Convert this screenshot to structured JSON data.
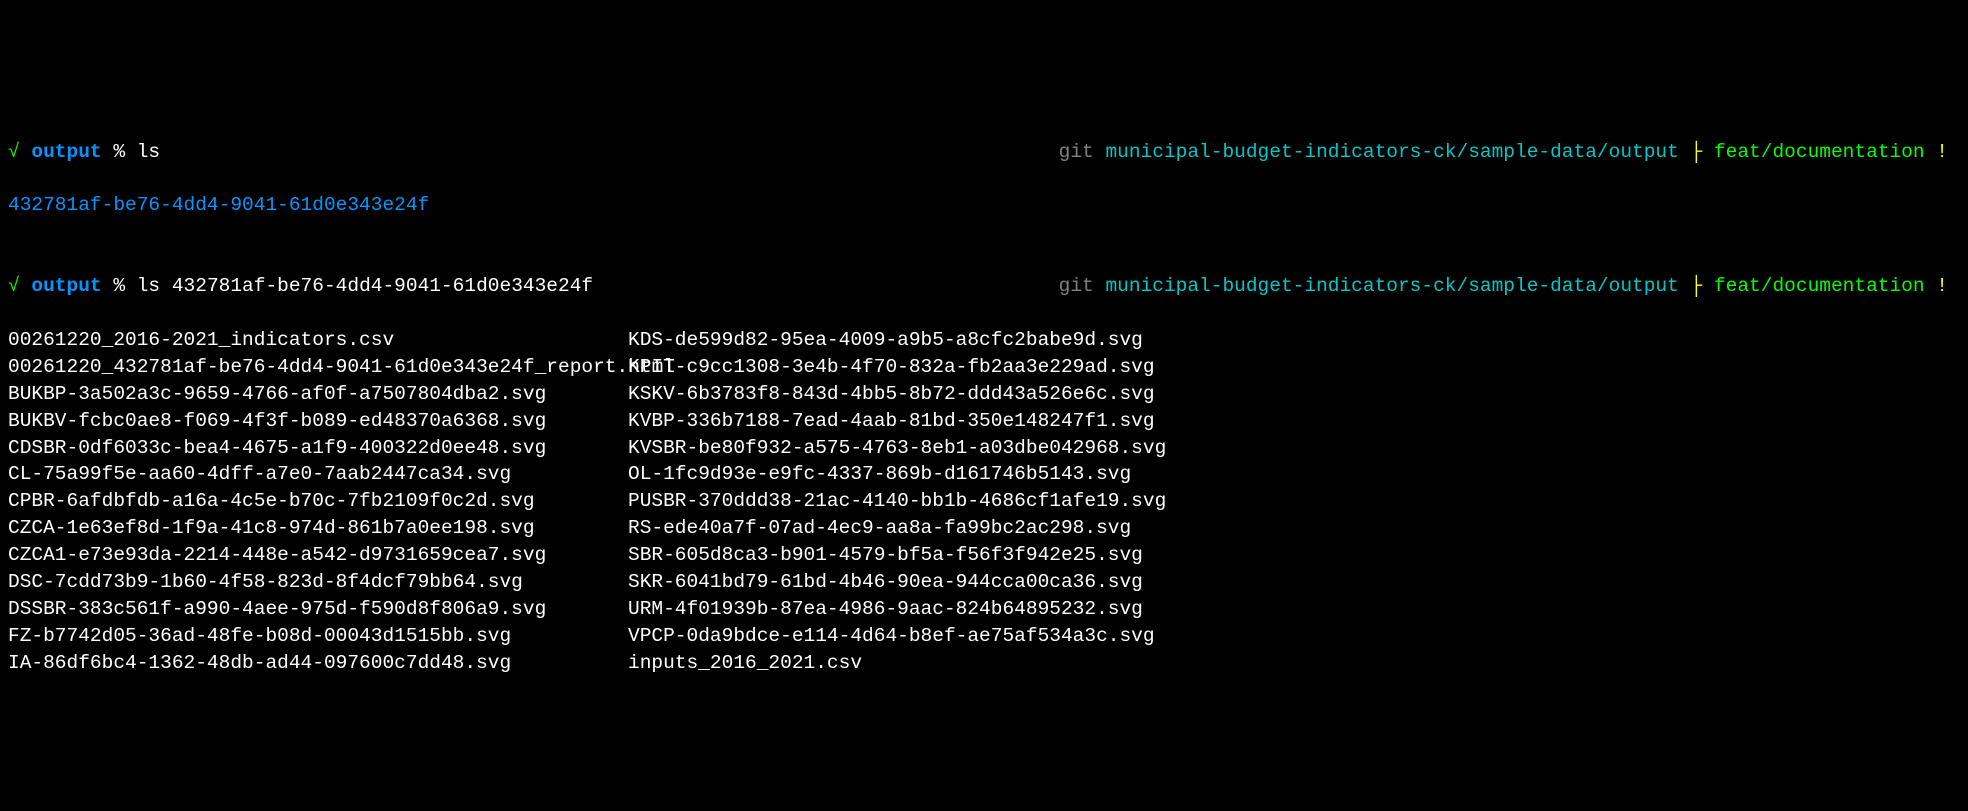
{
  "prompt1": {
    "check": "√",
    "dir": "output",
    "pct": "%",
    "command": "ls",
    "git_label": "git",
    "git_path": "municipal-budget-indicators-ck/sample-data/output",
    "branch_sym": "├",
    "branch": "feat/documentation",
    "excl": "!"
  },
  "output1": {
    "line": "432781af-be76-4dd4-9041-61d0e343e24f"
  },
  "prompt2": {
    "check": "√",
    "dir": "output",
    "pct": "%",
    "command": "ls 432781af-be76-4dd4-9041-61d0e343e24f",
    "git_label": "git",
    "git_path": "municipal-budget-indicators-ck/sample-data/output",
    "branch_sym": "├",
    "branch": "feat/documentation",
    "excl": "!"
  },
  "listing": {
    "col1": [
      "00261220_2016-2021_indicators.csv",
      "00261220_432781af-be76-4dd4-9041-61d0e343e24f_report.html",
      "BUKBP-3a502a3c-9659-4766-af0f-a7507804dba2.svg",
      "BUKBV-fcbc0ae8-f069-4f3f-b089-ed48370a6368.svg",
      "CDSBR-0df6033c-bea4-4675-a1f9-400322d0ee48.svg",
      "CL-75a99f5e-aa60-4dff-a7e0-7aab2447ca34.svg",
      "CPBR-6afdbfdb-a16a-4c5e-b70c-7fb2109f0c2d.svg",
      "CZCA-1e63ef8d-1f9a-41c8-974d-861b7a0ee198.svg",
      "CZCA1-e73e93da-2214-448e-a542-d9731659cea7.svg",
      "DSC-7cdd73b9-1b60-4f58-823d-8f4dcf79bb64.svg",
      "DSSBR-383c561f-a990-4aee-975d-f590d8f806a9.svg",
      "FZ-b7742d05-36ad-48fe-b08d-00043d1515bb.svg",
      "IA-86df6bc4-1362-48db-ad44-097600c7dd48.svg"
    ],
    "col2": [
      "KDS-de599d82-95ea-4009-a9b5-a8cfc2babe9d.svg",
      "KPIT-c9cc1308-3e4b-4f70-832a-fb2aa3e229ad.svg",
      "KSKV-6b3783f8-843d-4bb5-8b72-ddd43a526e6c.svg",
      "KVBP-336b7188-7ead-4aab-81bd-350e148247f1.svg",
      "KVSBR-be80f932-a575-4763-8eb1-a03dbe042968.svg",
      "OL-1fc9d93e-e9fc-4337-869b-d161746b5143.svg",
      "PUSBR-370ddd38-21ac-4140-bb1b-4686cf1afe19.svg",
      "RS-ede40a7f-07ad-4ec9-aa8a-fa99bc2ac298.svg",
      "SBR-605d8ca3-b901-4579-bf5a-f56f3f942e25.svg",
      "SKR-6041bd79-61bd-4b46-90ea-944cca00ca36.svg",
      "URM-4f01939b-87ea-4986-9aac-824b64895232.svg",
      "VPCP-0da9bdce-e114-4d64-b8ef-ae75af534a3c.svg",
      "inputs_2016_2021.csv"
    ]
  }
}
